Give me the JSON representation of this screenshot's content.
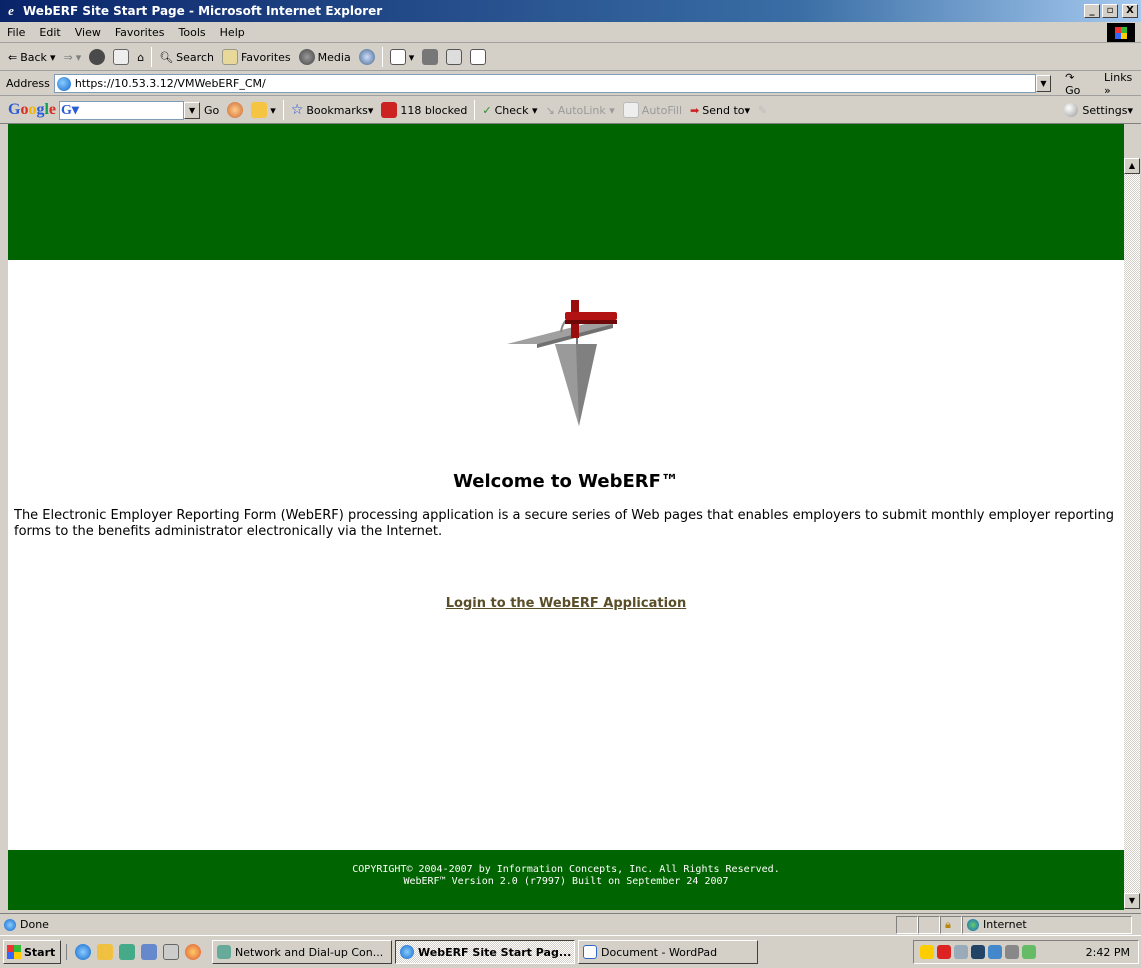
{
  "window": {
    "title": "WebERF Site Start Page - Microsoft Internet Explorer",
    "icon_glyph": "e",
    "btn_min": "_",
    "btn_max": "▫",
    "btn_close": "X"
  },
  "menu": [
    "File",
    "Edit",
    "View",
    "Favorites",
    "Tools",
    "Help"
  ],
  "toolbar": {
    "back": "Back",
    "search": "Search",
    "favorites": "Favorites",
    "media": "Media"
  },
  "address": {
    "label": "Address",
    "url": "https://10.53.3.12/VMWebERF_CM/",
    "go": "Go",
    "links": "Links »"
  },
  "google_toolbar": {
    "logo_letters": [
      "G",
      "o",
      "o",
      "g",
      "l",
      "e"
    ],
    "search_glyph": "G▾",
    "go": "Go",
    "bookmarks": "Bookmarks▾",
    "blocked": "118 blocked",
    "check": "Check ▾",
    "autolink": "AutoLink ▾",
    "autofill": "AutoFill",
    "send_to": "Send to▾",
    "settings": "Settings▾"
  },
  "page": {
    "welcome": "Welcome to WebERF™",
    "intro": "The Electronic Employer Reporting Form (WebERF) processing application is a secure series of Web pages that enables employers to submit monthly employer reporting forms to the benefits administrator electronically via the Internet.",
    "login_link": "Login to the WebERF Application",
    "footer_line1": "COPYRIGHT© 2004-2007 by Information Concepts, Inc. All Rights Reserved.",
    "footer_line2": "WebERF™ Version 2.0 (r7997) Built on September 24 2007"
  },
  "status": {
    "text": "Done",
    "zone": "Internet"
  },
  "taskbar": {
    "start": "Start",
    "tasks": [
      "Network and Dial-up Con...",
      "WebERF Site Start Pag...",
      "Document - WordPad"
    ],
    "clock": "2:42 PM"
  },
  "colors": {
    "brand_green": "#006400",
    "link": "#5a4e28"
  }
}
